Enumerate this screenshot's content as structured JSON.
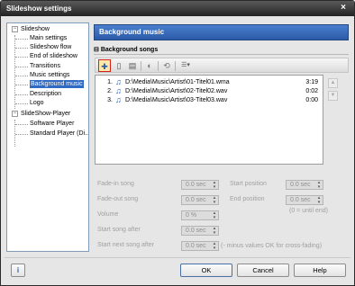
{
  "window": {
    "title": "Slideshow settings",
    "close_glyph": "×"
  },
  "tree": {
    "items": [
      {
        "label": "Slideshow",
        "expander": "−"
      },
      {
        "label": "Main settings"
      },
      {
        "label": "Slideshow flow"
      },
      {
        "label": "End of slideshow"
      },
      {
        "label": "Transitions"
      },
      {
        "label": "Music settings"
      },
      {
        "label": "Background music",
        "selected": true
      },
      {
        "label": "Description"
      },
      {
        "label": "Logo"
      },
      {
        "label": "SlideShow-Player",
        "expander": "−"
      },
      {
        "label": "Software Player"
      },
      {
        "label": "Standard Player (Di..."
      }
    ]
  },
  "panel": {
    "title": "Background music",
    "group_title": "Background songs",
    "group_glyph": "⊟"
  },
  "toolbar": {
    "buttons": [
      {
        "name": "add-song-icon",
        "glyph": "✚",
        "active": true
      },
      {
        "name": "delete-song-icon",
        "glyph": "▯"
      },
      {
        "name": "edit-song-icon",
        "glyph": "▤"
      },
      {
        "name": "volume-icon",
        "glyph": "◐"
      },
      {
        "name": "effects-icon",
        "glyph": "⟲"
      },
      {
        "name": "list-menu-icon",
        "glyph": "☰▾"
      }
    ]
  },
  "songs": [
    {
      "num": "1.",
      "path": "D:\\Media\\Music\\Artist\\01-Titel01.wma",
      "duration": "3:19"
    },
    {
      "num": "2.",
      "path": "D:\\Media\\Music\\Artist\\02-Titel02.wav",
      "duration": "0:02"
    },
    {
      "num": "3.",
      "path": "D:\\Media\\Music\\Artist\\03-Titel03.wav",
      "duration": "0:00"
    }
  ],
  "side_buttons": {
    "up": "▲",
    "down": "▼"
  },
  "fields": {
    "fade_in": {
      "label": "Fade-in song",
      "value": "0.0 sec"
    },
    "fade_out": {
      "label": "Fade-out song",
      "value": "0.0 sec"
    },
    "volume": {
      "label": "Volume",
      "value": "0 %"
    },
    "start_after": {
      "label": "Start song after",
      "value": "0.0 sec"
    },
    "start_next": {
      "label": "Start next song after",
      "value": "0.0 sec",
      "note": "(- minus values OK for cross-fading)"
    },
    "start_pos": {
      "label": "Start position",
      "value": "0.0 sec"
    },
    "end_pos": {
      "label": "End position",
      "value": "0.0 sec",
      "note": "(0 = until end)"
    },
    "spin_up": "▴",
    "spin_down": "▾"
  },
  "buttons": {
    "ok": "OK",
    "cancel": "Cancel",
    "help": "Help",
    "help_icon": "i"
  },
  "colors": {
    "header": "#2b5aa6",
    "selection": "#316ac5",
    "note_icon": "#2460b4"
  }
}
